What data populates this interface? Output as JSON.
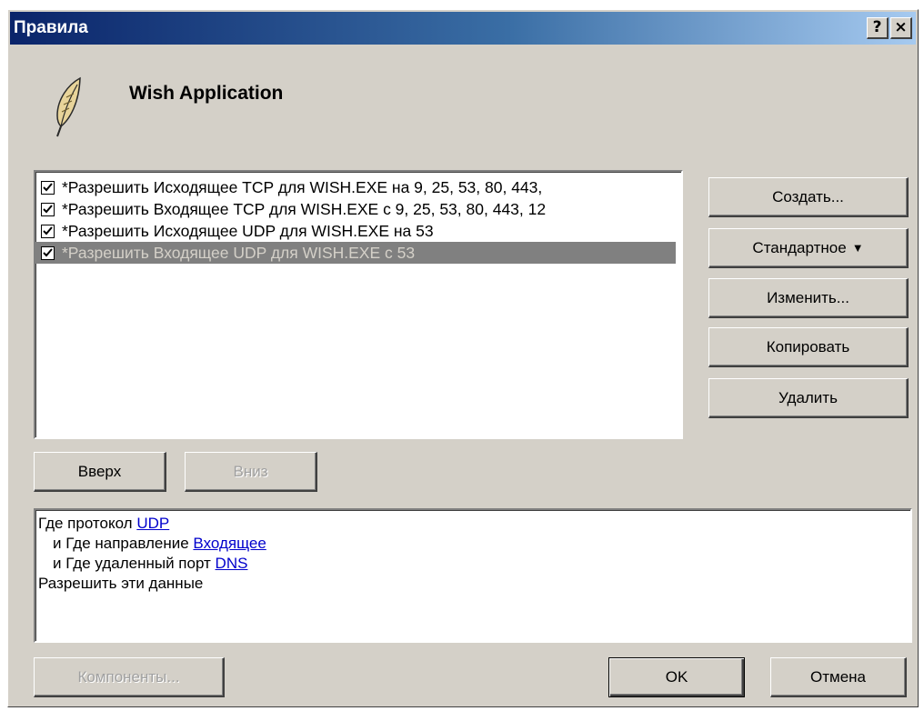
{
  "window": {
    "title": "Правила",
    "help_label": "?",
    "close_label": "×"
  },
  "app": {
    "name": "Wish Application",
    "icon": "feather-icon"
  },
  "rules": [
    {
      "label": "*Разрешить Исходящее TCP для WISH.EXE на 9, 25, 53, 80, 443,",
      "checked": true,
      "selected": false
    },
    {
      "label": "*Разрешить Входящее TCP для WISH.EXE с 9, 25, 53, 80, 443, 12",
      "checked": true,
      "selected": false
    },
    {
      "label": "*Разрешить Исходящее UDP для WISH.EXE на 53",
      "checked": true,
      "selected": false
    },
    {
      "label": "*Разрешить Входящее UDP для WISH.EXE с 53",
      "checked": true,
      "selected": true
    }
  ],
  "side_buttons": {
    "create": "Создать...",
    "standard": "Стандартное",
    "edit": "Изменить...",
    "copy": "Копировать",
    "delete": "Удалить"
  },
  "move_buttons": {
    "up": "Вверх",
    "down": "Вниз"
  },
  "description": {
    "line1_prefix": "Где протокол ",
    "line1_link": "UDP",
    "line2_prefix": "и Где направление ",
    "line2_link": "Входящее",
    "line3_prefix": "и Где удаленный порт ",
    "line3_link": "DNS",
    "line4": "Разрешить эти данные"
  },
  "bottom_buttons": {
    "components": "Компоненты...",
    "ok": "OK",
    "cancel": "Отмена"
  }
}
